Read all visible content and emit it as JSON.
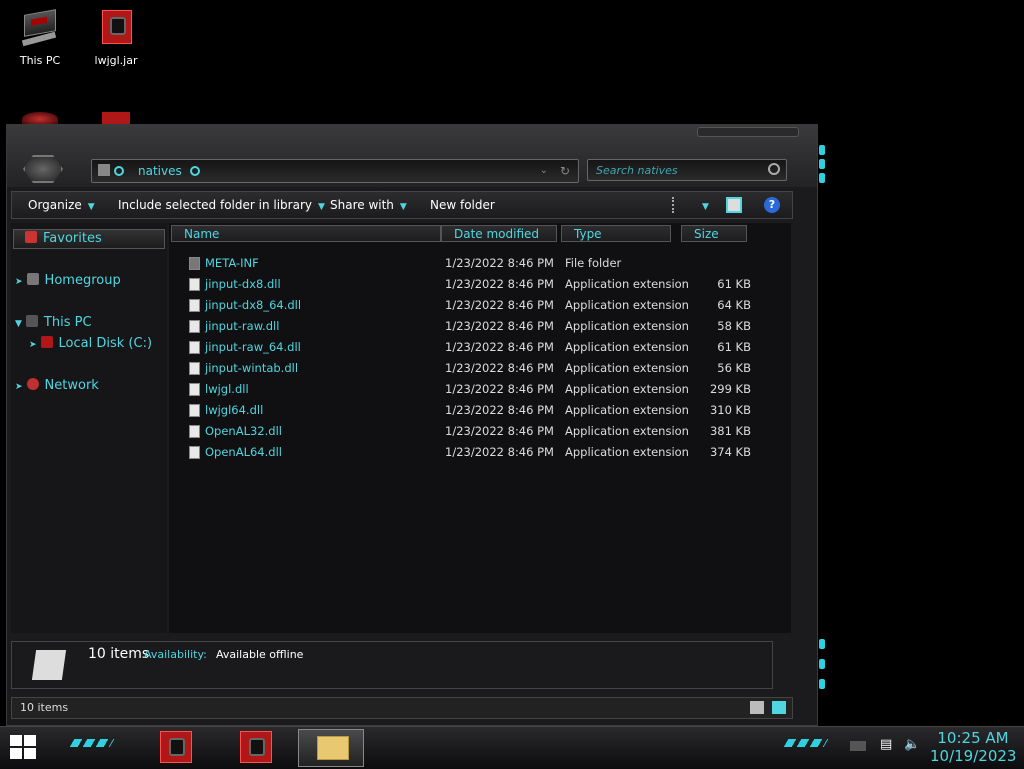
{
  "desktop": {
    "icons": [
      {
        "label": "This PC"
      },
      {
        "label": "lwjgl.jar"
      }
    ]
  },
  "explorer": {
    "address": {
      "current_folder": "natives"
    },
    "search": {
      "placeholder": "Search natives"
    },
    "toolbar": {
      "organize": "Organize",
      "include_library": "Include selected folder in library",
      "share_with": "Share with",
      "new_folder": "New folder"
    },
    "nav": {
      "favorites": "Favorites",
      "homegroup": "Homegroup",
      "this_pc": "This PC",
      "local_disk": "Local Disk (C:)",
      "network": "Network"
    },
    "columns": {
      "name": "Name",
      "date_modified": "Date modified",
      "type": "Type",
      "size": "Size"
    },
    "files": [
      {
        "name": "META-INF",
        "date": "1/23/2022 8:46 PM",
        "type": "File folder",
        "size": ""
      },
      {
        "name": "jinput-dx8.dll",
        "date": "1/23/2022 8:46 PM",
        "type": "Application extension",
        "size": "61 KB"
      },
      {
        "name": "jinput-dx8_64.dll",
        "date": "1/23/2022 8:46 PM",
        "type": "Application extension",
        "size": "64 KB"
      },
      {
        "name": "jinput-raw.dll",
        "date": "1/23/2022 8:46 PM",
        "type": "Application extension",
        "size": "58 KB"
      },
      {
        "name": "jinput-raw_64.dll",
        "date": "1/23/2022 8:46 PM",
        "type": "Application extension",
        "size": "61 KB"
      },
      {
        "name": "jinput-wintab.dll",
        "date": "1/23/2022 8:46 PM",
        "type": "Application extension",
        "size": "56 KB"
      },
      {
        "name": "lwjgl.dll",
        "date": "1/23/2022 8:46 PM",
        "type": "Application extension",
        "size": "299 KB"
      },
      {
        "name": "lwjgl64.dll",
        "date": "1/23/2022 8:46 PM",
        "type": "Application extension",
        "size": "310 KB"
      },
      {
        "name": "OpenAL32.dll",
        "date": "1/23/2022 8:46 PM",
        "type": "Application extension",
        "size": "381 KB"
      },
      {
        "name": "OpenAL64.dll",
        "date": "1/23/2022 8:46 PM",
        "type": "Application extension",
        "size": "374 KB"
      }
    ],
    "details": {
      "count": "10 items",
      "availability_label": "Availability:",
      "availability_value": "Available offline"
    },
    "status": {
      "items": "10 items"
    }
  },
  "taskbar": {
    "time": "10:25 AM",
    "date": "10/19/2023"
  },
  "colors": {
    "accent": "#4fd6e0",
    "brand_red": "#b01818"
  }
}
